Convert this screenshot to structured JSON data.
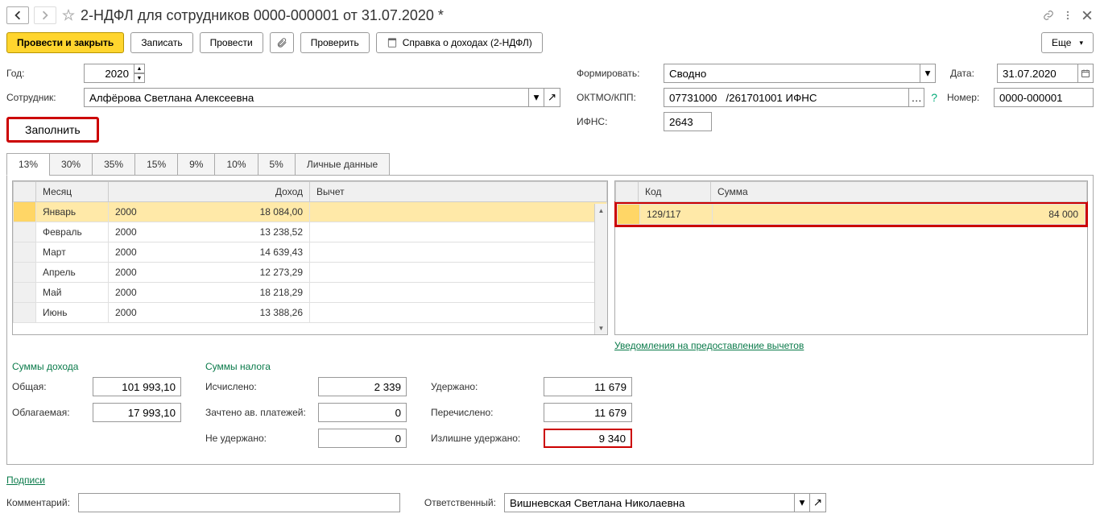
{
  "title": "2-НДФЛ для сотрудников 0000-000001 от 31.07.2020 *",
  "toolbar": {
    "post_close": "Провести и закрыть",
    "save": "Записать",
    "post": "Провести",
    "check": "Проверить",
    "report": "Справка о доходах (2-НДФЛ)",
    "more": "Еще"
  },
  "fields": {
    "year_lbl": "Год:",
    "year": "2020",
    "employee_lbl": "Сотрудник:",
    "employee": "Алфёрова Светлана Алексеевна",
    "fill": "Заполнить",
    "form_lbl": "Формировать:",
    "form_val": "Сводно",
    "date_lbl": "Дата:",
    "date": "31.07.2020",
    "oktmo_lbl": "ОКТМО/КПП:",
    "oktmo": "07731000   /261701001 ИФНС",
    "number_lbl": "Номер:",
    "number": "0000-000001",
    "ifns_lbl": "ИФНС:",
    "ifns": "2643"
  },
  "tabs": [
    "13%",
    "30%",
    "35%",
    "15%",
    "9%",
    "10%",
    "5%",
    "Личные данные"
  ],
  "income_headers": {
    "month": "Месяц",
    "income": "Доход",
    "amount": "",
    "deduction": "Вычет"
  },
  "income_rows": [
    {
      "month": "Январь",
      "code": "2000",
      "amount": "18 084,00"
    },
    {
      "month": "Февраль",
      "code": "2000",
      "amount": "13 238,52"
    },
    {
      "month": "Март",
      "code": "2000",
      "amount": "14 639,43"
    },
    {
      "month": "Апрель",
      "code": "2000",
      "amount": "12 273,29"
    },
    {
      "month": "Май",
      "code": "2000",
      "amount": "18 218,29"
    },
    {
      "month": "Июнь",
      "code": "2000",
      "amount": "13 388,26"
    }
  ],
  "deduct_headers": {
    "code": "Код",
    "sum": "Сумма"
  },
  "deduct_rows": [
    {
      "code": "129/117",
      "sum": "84 000"
    }
  ],
  "deduct_link": "Уведомления на предоставление вычетов",
  "sums": {
    "income_head": "Суммы дохода",
    "tax_head": "Суммы налога",
    "total_lbl": "Общая:",
    "total": "101 993,10",
    "taxable_lbl": "Облагаемая:",
    "taxable": "17 993,10",
    "calc_lbl": "Исчислено:",
    "calc": "2 339",
    "offset_lbl": "Зачтено ав. платежей:",
    "offset": "0",
    "notheld_lbl": "Не удержано:",
    "notheld": "0",
    "held_lbl": "Удержано:",
    "held": "11 679",
    "transf_lbl": "Перечислено:",
    "transf": "11 679",
    "excess_lbl": "Излишне удержано:",
    "excess": "9 340"
  },
  "footer": {
    "sign": "Подписи",
    "comment_lbl": "Комментарий:",
    "comment": "",
    "resp_lbl": "Ответственный:",
    "resp": "Вишневская Светлана Николаевна"
  }
}
